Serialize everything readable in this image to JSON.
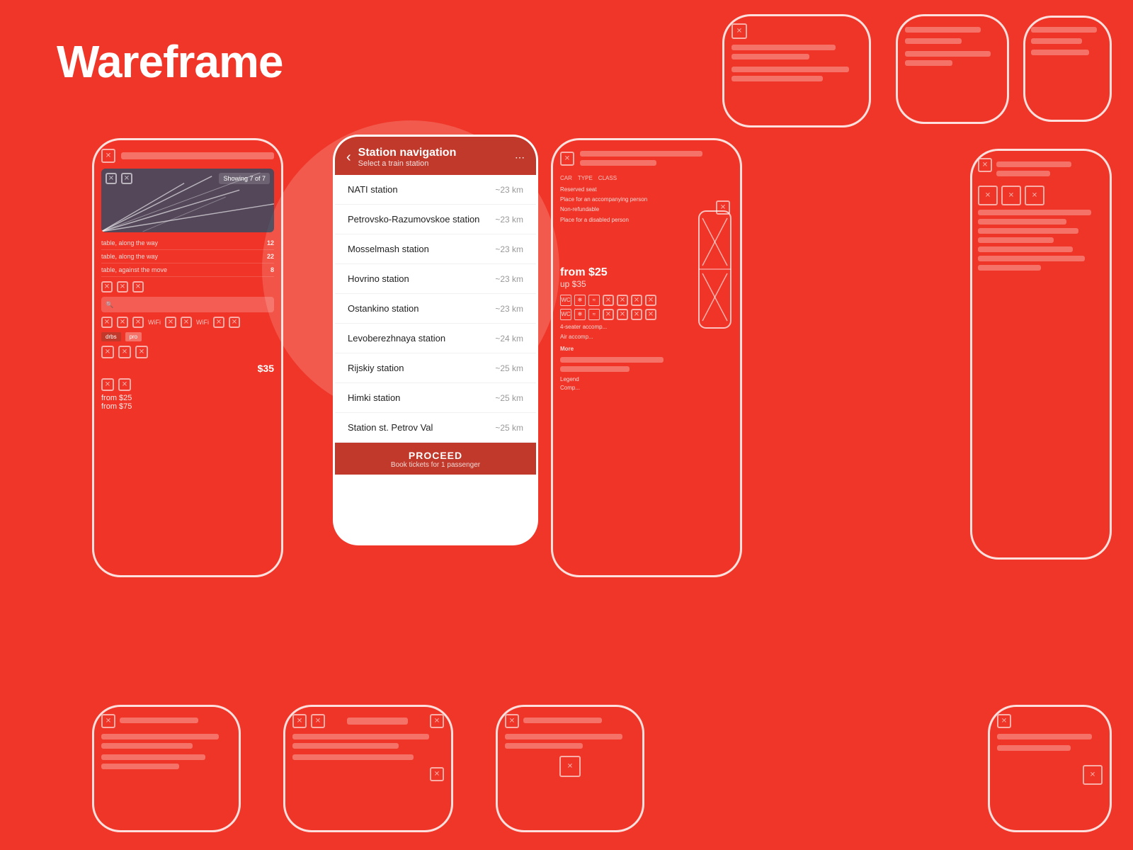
{
  "app": {
    "title": "Wareframe",
    "bg_color": "#f03628"
  },
  "center_phone": {
    "header": {
      "back_label": "‹",
      "title": "Station navigation",
      "subtitle": "Select a train station",
      "menu_icon": "⋯"
    },
    "stations": [
      {
        "name": "NATI station",
        "distance": "~23 km"
      },
      {
        "name": "Petrovsko-Razumovskoe station",
        "distance": "~23 km"
      },
      {
        "name": "Mosselmash station",
        "distance": "~23 km"
      },
      {
        "name": "Hovrino station",
        "distance": "~23 km"
      },
      {
        "name": "Ostankino station",
        "distance": "~23 km"
      },
      {
        "name": "Levoberezhnaya station",
        "distance": "~24 km"
      },
      {
        "name": "Rijskiy station",
        "distance": "~25 km"
      },
      {
        "name": "Himki station",
        "distance": "~25 km"
      },
      {
        "name": "Station st. Petrov Val",
        "distance": "~25 km"
      }
    ],
    "footer": {
      "proceed_label": "PROCEED",
      "proceed_sub": "Book tickets for 1 passenger"
    }
  },
  "left_phone": {
    "showing_label": "Showing 7 of 7",
    "list_items": [
      {
        "text": "table, along the way",
        "num": "12"
      },
      {
        "text": "table, along the way",
        "num": "22"
      },
      {
        "text": "table, against the move",
        "num": "8"
      }
    ],
    "price": "$35",
    "from_price": "from $25",
    "up_price": "from $75"
  },
  "right_phone": {
    "section": {
      "car_label": "CAR",
      "type_label": "TYPE",
      "class_label": "CLASS"
    },
    "reserved": "Reserved seat",
    "place_for_an": "Place for an accompanying person",
    "non_refundable": "Non-refundable",
    "place_disabled": "Place for a disabled person",
    "price_from": "from $25",
    "price_up": "up $35",
    "more_label": "More",
    "legend_label": "Legend",
    "comp_label": "Comp..."
  },
  "icons": {
    "wc": "WC",
    "snow": "❄",
    "wifi": "WiFi",
    "x_icon": "✕"
  }
}
